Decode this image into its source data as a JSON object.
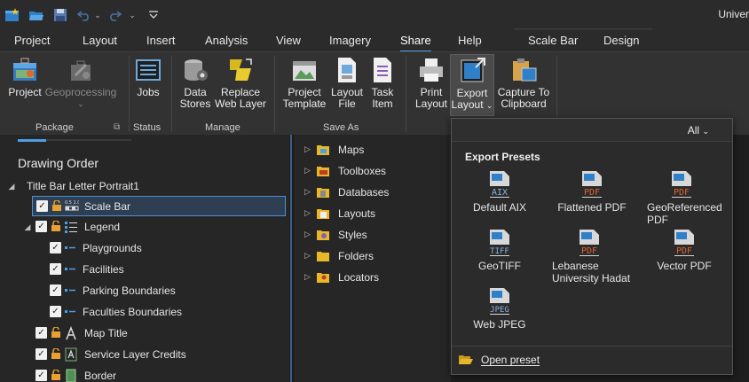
{
  "title_bar": {
    "app_title": "Univer",
    "qat_icons": [
      "new-project-icon",
      "open-project-icon",
      "save-project-icon",
      "undo-icon",
      "undo-dropdown-icon",
      "redo-icon",
      "redo-dropdown-icon",
      "customize-qat-icon"
    ]
  },
  "tabs": [
    "Project",
    "Layout",
    "Insert",
    "Analysis",
    "View",
    "Imagery",
    "Share",
    "Help"
  ],
  "active_tab": "Share",
  "contextual_tabs": [
    "Scale Bar",
    "Design"
  ],
  "ribbon": {
    "package": {
      "label": "Package",
      "project": "Project",
      "geoprocessing": "Geoprocessing"
    },
    "status": {
      "label": "Status",
      "jobs": "Jobs"
    },
    "manage": {
      "label": "Manage",
      "data_stores_1": "Data",
      "data_stores_2": "Stores",
      "replace_1": "Replace",
      "replace_2": "Web Layer"
    },
    "save_as": {
      "label": "Save As",
      "project_template_1": "Project",
      "project_template_2": "Template",
      "layout_file_1": "Layout",
      "layout_file_2": "File",
      "task_item_1": "Task",
      "task_item_2": "Item"
    },
    "output": {
      "print_1": "Print",
      "print_2": "Layout",
      "export_1": "Export",
      "export_2": "Layout",
      "capture_1": "Capture To",
      "capture_2": "Clipboard"
    }
  },
  "drawing_order": {
    "title": "Drawing Order",
    "items": [
      {
        "label": "Title Bar Letter Portrait1"
      },
      {
        "label": "Scale Bar"
      },
      {
        "label": "Legend"
      },
      {
        "label": "Playgrounds"
      },
      {
        "label": "Facilities"
      },
      {
        "label": "Parking Boundaries"
      },
      {
        "label": "Faculties Boundaries"
      },
      {
        "label": "Map Title"
      },
      {
        "label": "Service Layer Credits"
      },
      {
        "label": "Border"
      }
    ]
  },
  "catalog": {
    "items": [
      {
        "label": "Maps"
      },
      {
        "label": "Toolboxes"
      },
      {
        "label": "Databases"
      },
      {
        "label": "Layouts"
      },
      {
        "label": "Styles"
      },
      {
        "label": "Folders"
      },
      {
        "label": "Locators"
      }
    ]
  },
  "export_dropdown": {
    "filter": "All",
    "heading": "Export Presets",
    "presets": [
      {
        "line1": "Default AIX",
        "line2": "",
        "badge": "AIX",
        "badge_color": "#8cb4e0"
      },
      {
        "line1": "Flattened PDF",
        "line2": "",
        "badge": "PDF",
        "badge_color": "#e0662e"
      },
      {
        "line1": "GeoReferenced",
        "line2": "PDF",
        "badge": "PDF",
        "badge_color": "#e0662e"
      },
      {
        "line1": "GeoTIFF",
        "line2": "",
        "badge": "TIFF",
        "badge_color": "#8cb4e0"
      },
      {
        "line1": "Lebanese",
        "line2": "University Hadat",
        "badge": "PDF",
        "badge_color": "#e0662e"
      },
      {
        "line1": "Vector PDF",
        "line2": "",
        "badge": "PDF",
        "badge_color": "#e0662e"
      },
      {
        "line1": "Web JPEG",
        "line2": "",
        "badge": "JPEG",
        "badge_color": "#8cb4e0"
      }
    ],
    "open_preset": "Open preset"
  },
  "colors": {
    "accent": "#4aa0e6",
    "selection_border": "#4a90d9",
    "folder_yellow": "#e8b829",
    "pdf_orange": "#e0662e"
  }
}
